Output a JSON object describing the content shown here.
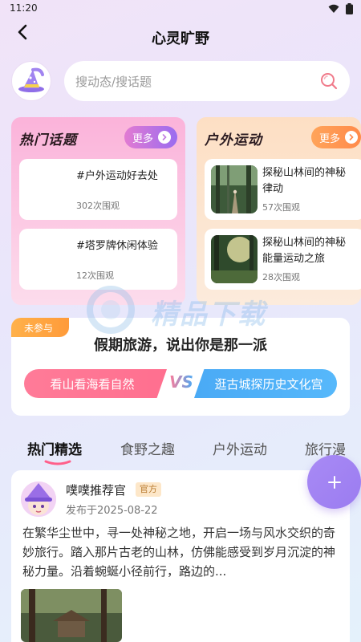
{
  "status_bar": {
    "time": "11:20"
  },
  "nav": {
    "title": "心灵旷野"
  },
  "search": {
    "placeholder": "搜动态/搜话题"
  },
  "hot_topics": {
    "title": "热门话题",
    "more_label": "更多",
    "items": [
      {
        "title": "#户外运动好去处",
        "views": "302次围观"
      },
      {
        "title": "#塔罗牌休闲体验",
        "views": "12次围观"
      }
    ]
  },
  "outdoor": {
    "title": "户外运动",
    "more_label": "更多",
    "items": [
      {
        "title_line1": "探秘山林间的神秘",
        "title_line2": "律动",
        "views": "57次围观"
      },
      {
        "title_line1": "探秘山林间的神秘",
        "title_line2": "能量运动之旅",
        "views": "28次围观"
      }
    ]
  },
  "watermark": {
    "text": "精品下载"
  },
  "vote": {
    "badge": "未参与",
    "question": "假期旅游，说出你是那一派",
    "option_left": "看山看海看自然",
    "vs": "VS",
    "option_right": "逛古城探历史文化宫"
  },
  "tabs": [
    {
      "label": "热门精选",
      "active": true
    },
    {
      "label": "食野之趣",
      "active": false
    },
    {
      "label": "户外运动",
      "active": false
    },
    {
      "label": "旅行漫",
      "active": false
    }
  ],
  "fab": {
    "icon": "plus-icon"
  },
  "post": {
    "author": "噗噗推荐官",
    "tag": "官方",
    "date": "发布于2025-08-22",
    "body": "在繁华尘世中，寻一处神秘之地，开启一场与风水交织的奇妙旅行。踏入那片古老的山林，仿佛能感受到岁月沉淀的神秘力量。沿着蜿蜒小径前行，路边的..."
  },
  "colors": {
    "accent_purple": "#9b7cf0",
    "pink_option": "#ff7b98",
    "blue_option": "#4aaaf5",
    "badge_orange": "#ffa43f"
  }
}
